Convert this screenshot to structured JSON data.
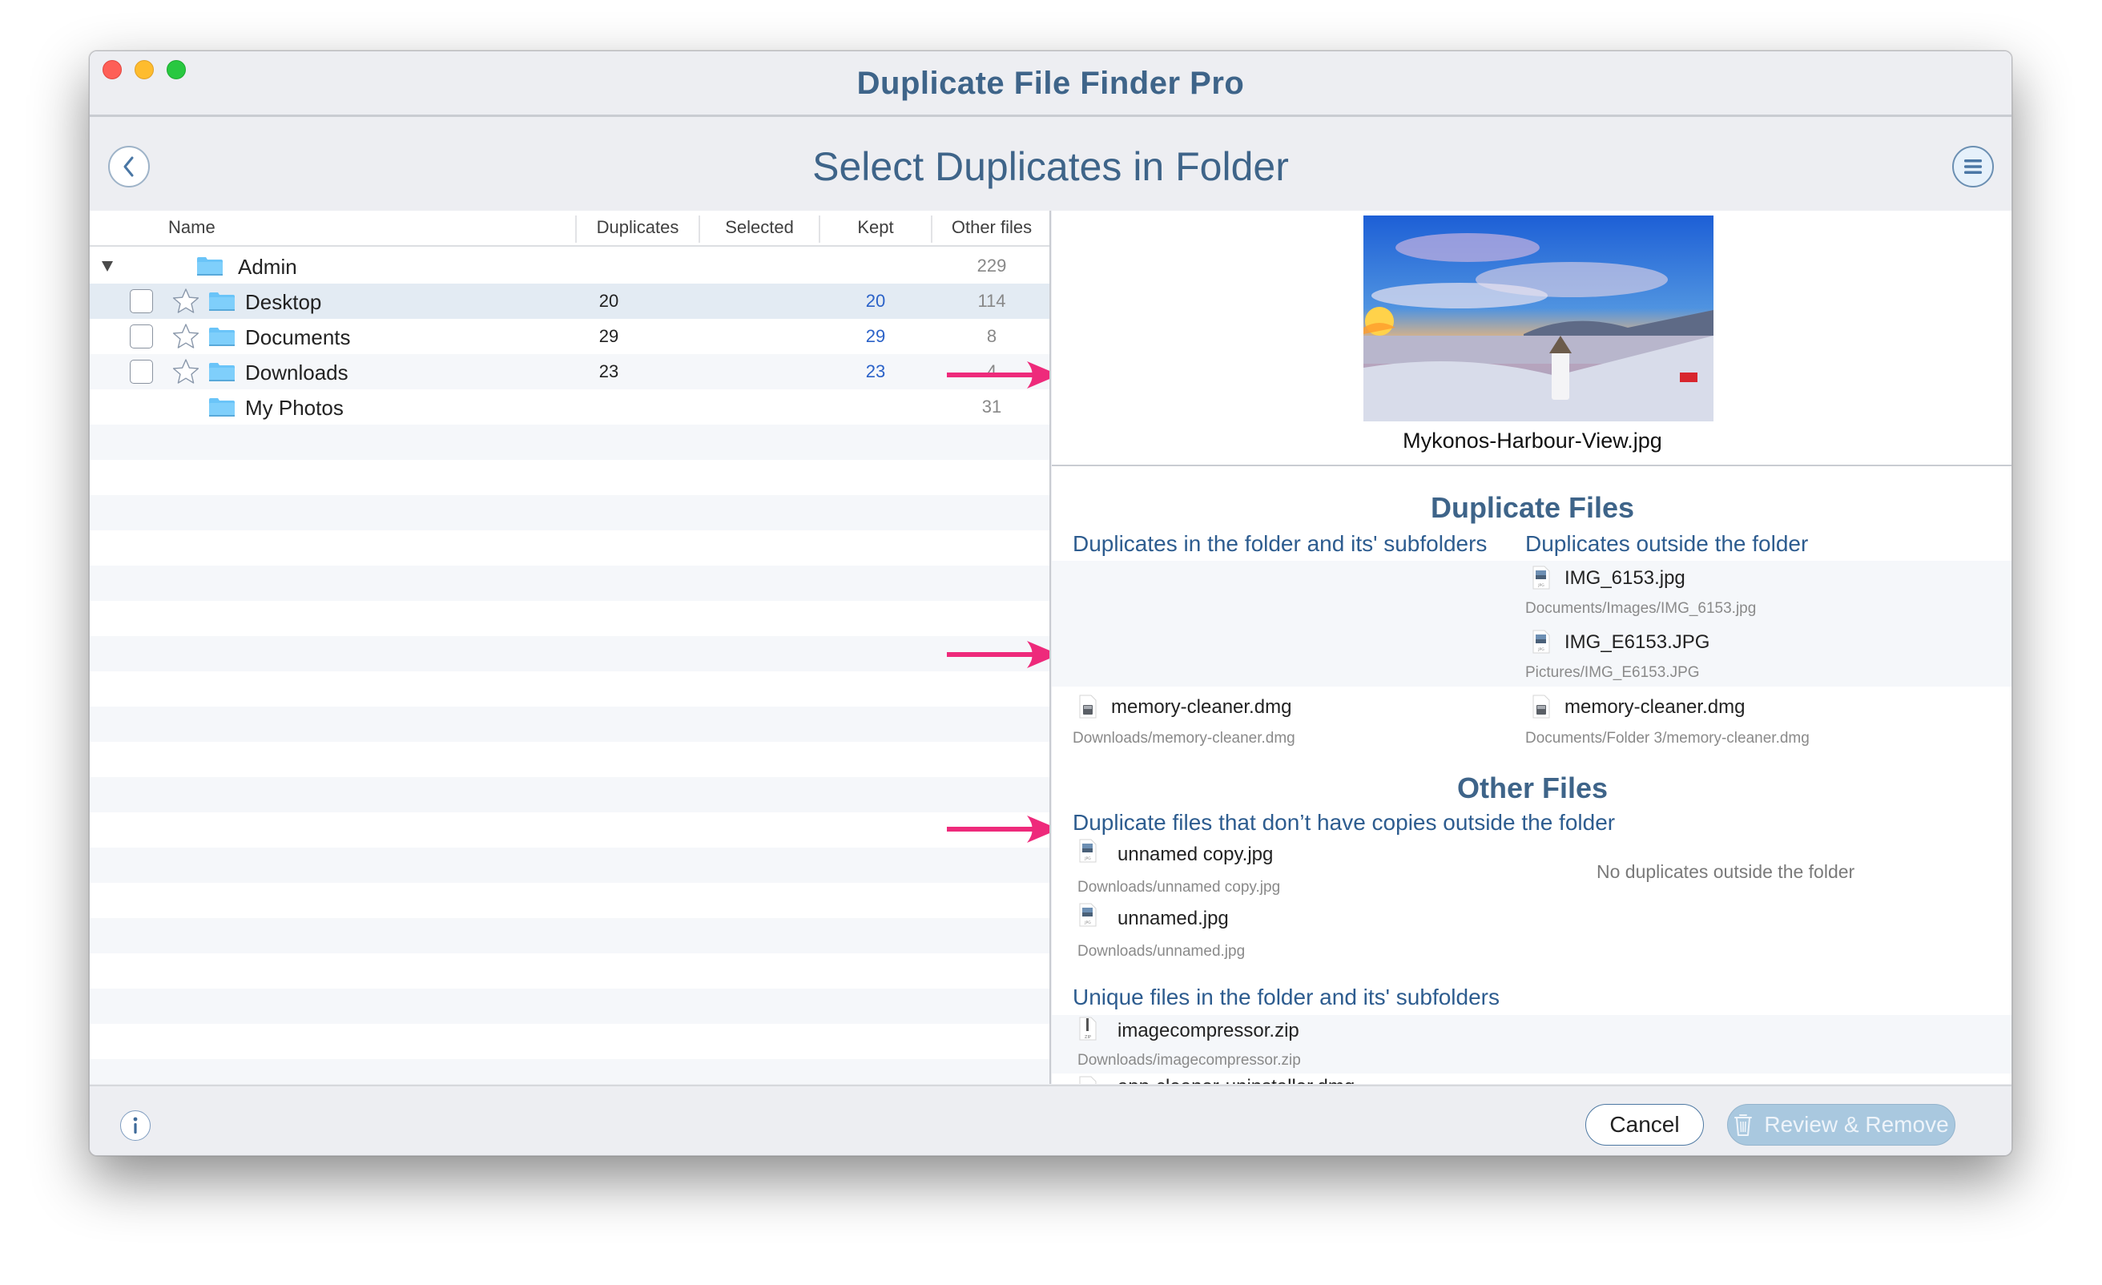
{
  "window": {
    "app_title": "Duplicate File Finder Pro",
    "page_title": "Select Duplicates in Folder"
  },
  "table": {
    "columns": [
      "Name",
      "Duplicates",
      "Selected",
      "Kept",
      "Other files"
    ],
    "rows": [
      {
        "name": "Admin",
        "duplicates": "",
        "selected": "",
        "kept": "",
        "other": "229",
        "expanded": true,
        "has_checkbox": false
      },
      {
        "name": "Desktop",
        "duplicates": "20",
        "selected": "",
        "kept": "20",
        "other": "114",
        "has_checkbox": true,
        "checked": false,
        "starred": false,
        "highlighted": true
      },
      {
        "name": "Documents",
        "duplicates": "29",
        "selected": "",
        "kept": "29",
        "other": "8",
        "has_checkbox": true,
        "checked": false,
        "starred": false
      },
      {
        "name": "Downloads",
        "duplicates": "23",
        "selected": "",
        "kept": "23",
        "other": "4",
        "has_checkbox": true,
        "checked": false,
        "starred": false
      },
      {
        "name": "My Photos",
        "duplicates": "",
        "selected": "",
        "kept": "",
        "other": "31",
        "has_checkbox": false
      }
    ]
  },
  "preview": {
    "file_name": "Mykonos-Harbour-View.jpg"
  },
  "duplicate_files": {
    "title": "Duplicate Files",
    "inside_label": "Duplicates in the folder and its' subfolders",
    "outside_label": "Duplicates outside the folder",
    "outside_group1": [
      {
        "name": "IMG_6153.jpg",
        "path": "Documents/Images/IMG_6153.jpg",
        "icon": "jpg-file-icon"
      },
      {
        "name": "IMG_E6153.JPG",
        "path": "Pictures/IMG_E6153.JPG",
        "icon": "jpg-file-icon"
      }
    ],
    "inside_group2": [
      {
        "name": "memory-cleaner.dmg",
        "path": "Downloads/memory-cleaner.dmg",
        "icon": "dmg-file-icon"
      }
    ],
    "outside_group2": [
      {
        "name": "memory-cleaner.dmg",
        "path": "Documents/Folder 3/memory-cleaner.dmg",
        "icon": "dmg-file-icon"
      }
    ]
  },
  "other_files": {
    "title": "Other Files",
    "no_copies_label": "Duplicate files that don’t have copies outside the folder",
    "no_copies_files": [
      {
        "name": "unnamed copy.jpg",
        "path": "Downloads/unnamed copy.jpg",
        "icon": "jpg-file-icon"
      },
      {
        "name": "unnamed.jpg",
        "path": "Downloads/unnamed.jpg",
        "icon": "jpg-file-icon"
      }
    ],
    "no_duplicates_note": "No duplicates outside the folder",
    "unique_label": "Unique files in the folder and its' subfolders",
    "unique_files": [
      {
        "name": "imagecompressor.zip",
        "path": "Downloads/imagecompressor.zip",
        "icon": "zip-file-icon"
      },
      {
        "name": "app-cleaner-uninstaller.dmg",
        "path": "",
        "icon": "dmg-file-icon"
      }
    ]
  },
  "footer": {
    "cancel_label": "Cancel",
    "review_label": "Review & Remove",
    "review_enabled": false
  },
  "colors": {
    "accent": "#3e6489",
    "link_blue": "#2d5c8f",
    "kept_blue": "#2b62c8",
    "annotation_arrow": "#ee2a7b",
    "review_button": "#a9c8df"
  }
}
